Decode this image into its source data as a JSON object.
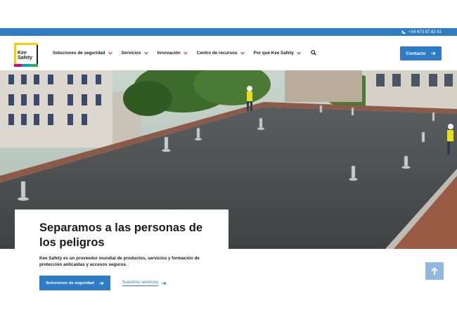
{
  "topbar": {
    "phone": "+34 673 87 82 61",
    "phone_icon": "phone-icon"
  },
  "logo": {
    "line1": "Kee",
    "line2": "Safety"
  },
  "nav": {
    "items": [
      {
        "label": "Soluciones de seguridad"
      },
      {
        "label": "Servicios"
      },
      {
        "label": "Innovación"
      },
      {
        "label": "Centro de recursos"
      },
      {
        "label": "Por qué Kee Safety"
      }
    ],
    "search_icon": "search-icon"
  },
  "contact": {
    "label": "Contacto"
  },
  "hero": {
    "headline": "Separamos a las personas de los peligros",
    "lead": "Kee Safety es un proveedor mundial de productos, servicios y formación de protección anticaídas y accesos seguros.",
    "primary_cta": "Soluciones de seguridad",
    "secondary_cta": "Nuestros servicios"
  },
  "colors": {
    "brand_blue": "#2f7cc6",
    "scroll_top": "#92b8df"
  }
}
